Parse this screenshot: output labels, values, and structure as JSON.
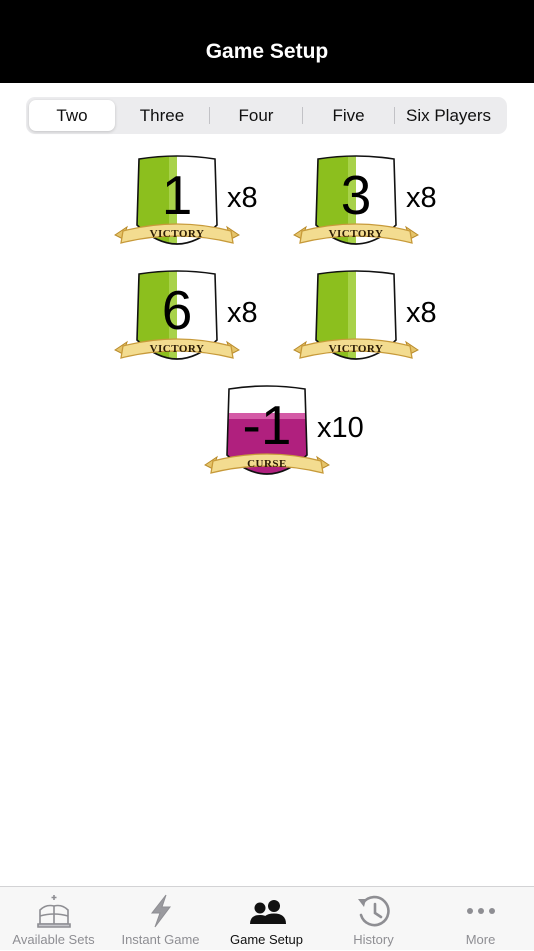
{
  "header": {
    "title": "Game Setup"
  },
  "player_count": {
    "options": [
      "Two",
      "Three",
      "Four",
      "Five",
      "Six Players"
    ],
    "selected": "Two"
  },
  "cards": [
    {
      "number": "1",
      "label": "VICTORY",
      "count": "x8",
      "color": "#8cbf1e"
    },
    {
      "number": "3",
      "label": "VICTORY",
      "count": "x8",
      "color": "#8cbf1e"
    },
    {
      "number": "6",
      "label": "VICTORY",
      "count": "x8",
      "color": "#8cbf1e"
    },
    {
      "number": "",
      "label": "VICTORY",
      "count": "x8",
      "color": "#8cbf1e"
    },
    {
      "number": "-1",
      "label": "CURSE",
      "count": "x10",
      "color": "#b0207e"
    }
  ],
  "tabbar": {
    "tabs": [
      {
        "label": "Available Sets",
        "icon": "crown-icon",
        "active": false
      },
      {
        "label": "Instant Game",
        "icon": "lightning-icon",
        "active": false
      },
      {
        "label": "Game Setup",
        "icon": "players-icon",
        "active": true
      },
      {
        "label": "History",
        "icon": "history-icon",
        "active": false
      },
      {
        "label": "More",
        "icon": "more-icon",
        "active": false
      }
    ]
  },
  "colors": {
    "victory": "#8cbf1e",
    "curse": "#b0207e",
    "banner": "#f3dc90",
    "banner_edge": "#c79a3a",
    "tab_inactive": "#8e8e93",
    "tab_active": "#111111"
  }
}
